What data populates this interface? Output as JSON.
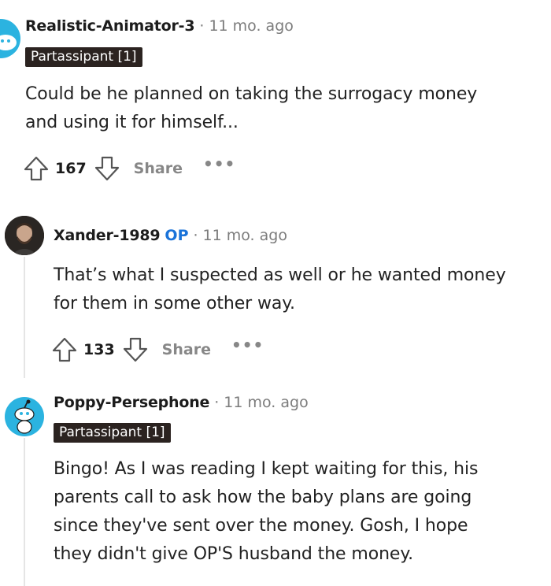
{
  "comments": [
    {
      "author": "Realistic-Animator-3",
      "separator": "·",
      "time": "11 mo. ago",
      "flair": "Partassipant [1]",
      "body_lines": [
        "Could be he planned on taking the surrogacy money",
        "and using it for himself..."
      ],
      "score": "167",
      "share_label": "Share",
      "more_label": "•••"
    },
    {
      "author": "Xander-1989",
      "op_badge": "OP",
      "separator": "·",
      "time": "11 mo. ago",
      "body_lines": [
        "That’s what I suspected as well or he wanted money",
        "for them in some other way."
      ],
      "score": "133",
      "share_label": "Share",
      "more_label": "•••"
    },
    {
      "author": "Poppy-Persephone",
      "separator": "·",
      "time": "11 mo. ago",
      "flair": "Partassipant [1]",
      "body_lines": [
        "Bingo! As I was reading I kept waiting for this, his",
        "parents call to ask how the baby plans are going",
        "since they've sent over the money. Gosh, I hope",
        "they didn't give OP'S husband the money."
      ]
    }
  ],
  "colors": {
    "op_badge": "#1a73d9",
    "flair_bg": "#2b2320",
    "snoo_avatar": "#2bb3e0",
    "muted_text": "#7c7c7c"
  },
  "icons": {
    "upvote": "arrow-up-outline-icon",
    "downvote": "arrow-down-outline-icon",
    "avatar_snoo": "reddit-snoo-avatar",
    "avatar_photo": "user-photo-avatar"
  }
}
